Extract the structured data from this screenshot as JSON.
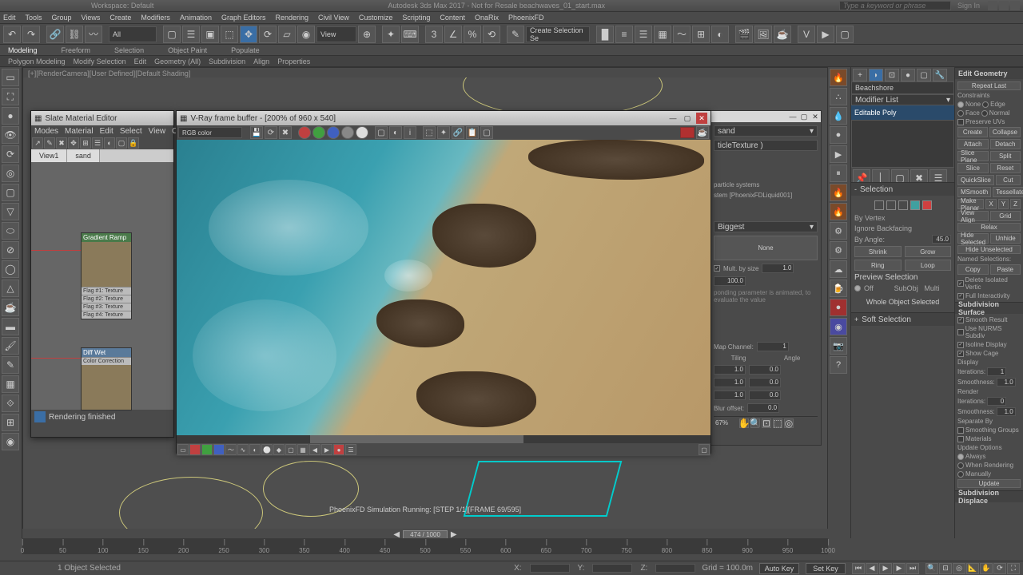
{
  "app": {
    "title": "Autodesk 3ds Max 2017 - Not for Resale   beachwaves_01_start.max",
    "workspace_label": "Workspace: Default",
    "search_placeholder": "Type a keyword or phrase",
    "signin": "Sign In"
  },
  "menu": [
    "Edit",
    "Tools",
    "Group",
    "Views",
    "Create",
    "Modifiers",
    "Animation",
    "Graph Editors",
    "Rendering",
    "Civil View",
    "Customize",
    "Scripting",
    "Content",
    "OnaRix",
    "PhoenixFD"
  ],
  "main_toolbar": {
    "dropdown_all": "All",
    "dropdown_view": "View",
    "dropdown_selset": "Create Selection Se"
  },
  "ribbon_tabs": [
    "Modeling",
    "Freeform",
    "Selection",
    "Object Paint",
    "Populate"
  ],
  "ribbon_sub": [
    "Polygon Modeling",
    "Modify Selection",
    "Edit",
    "Geometry (All)",
    "Subdivision",
    "Align",
    "Properties"
  ],
  "viewport": {
    "label": "[+][RenderCamera][User Defined][Default Shading]",
    "sim_status": "PhoenixFD Simulation Running: [STEP 1/1][FRAME 69/595]"
  },
  "slate": {
    "title": "Slate Material Editor",
    "menus": [
      "Modes",
      "Material",
      "Edit",
      "Select",
      "View",
      "Opt"
    ],
    "tabs": [
      "View1",
      "sand"
    ],
    "node1": {
      "head": "Gradient Ramp",
      "slots": [
        "Flag #1: Texture",
        "Flag #2: Texture",
        "Flag #3: Texture",
        "Flag #4: Texture"
      ]
    },
    "node2": {
      "head": "Diff Wet",
      "sub": "Color Correction"
    },
    "status": "Rendering finished"
  },
  "vfb": {
    "title": "V-Ray frame buffer - [200% of 960 x 540]",
    "channel": "RGB color"
  },
  "docked": {
    "name_field": "sand",
    "type_label": "ticleTexture )",
    "txt1": "particle systems",
    "txt2": "stem [PhoenixFDLiquid001]",
    "mode": "Biggest",
    "none": "None",
    "mult_label": "Mult. by size",
    "mult_val": "1.0",
    "val100": "100.0",
    "anim_note": "ponding parameter is animated, to evaluate the value",
    "map_channel": "Map Channel:",
    "map_channel_val": "1",
    "tiling": "Tiling",
    "angle": "Angle",
    "t1": "1.0",
    "t2": "1.0",
    "t3": "1.0",
    "a1": "0.0",
    "a2": "0.0",
    "a3": "0.0",
    "blur": "Blur offset:",
    "blur_val": "0.0",
    "zoom": "67%"
  },
  "command_panel": {
    "name": "Beachshore",
    "modifier_list": "Modifier List",
    "stack_item": "Editable Poly",
    "selection_head": "Selection",
    "by_vertex": "By Vertex",
    "ignore_backfacing": "Ignore Backfacing",
    "by_angle": "By Angle:",
    "by_angle_val": "45.0",
    "shrink": "Shrink",
    "grow": "Grow",
    "ring": "Ring",
    "loop": "Loop",
    "preview_sel": "Preview Selection",
    "off": "Off",
    "subobj": "SubObj",
    "multi": "Multi",
    "whole": "Whole Object Selected",
    "softsel_head": "Soft Selection"
  },
  "edit_geom": {
    "head": "Edit Geometry",
    "repeat": "Repeat Last",
    "constraints": "Constraints",
    "none": "None",
    "edge": "Edge",
    "face": "Face",
    "normal": "Normal",
    "preserve_uvs": "Preserve UVs",
    "create": "Create",
    "collapse": "Collapse",
    "attach": "Attach",
    "detach": "Detach",
    "slice_plane": "Slice Plane",
    "split": "Split",
    "slice": "Slice",
    "reset": "Reset",
    "quickslice": "QuickSlice",
    "cut": "Cut",
    "msmooth": "MSmooth",
    "tessellate": "Tessellate",
    "make_planar": "Make Planar",
    "x": "X",
    "y": "Y",
    "z": "Z",
    "view_align": "View Align",
    "grid_align": "Grid",
    "relax": "Relax",
    "hide_sel": "Hide Selected",
    "unhide": "Unhide",
    "hide_unsel": "Hide Unselected",
    "named_sel": "Named Selections:",
    "copy": "Copy",
    "paste": "Paste",
    "del_iso": "Delete Isolated Vertic",
    "full_int": "Full Interactivity",
    "subdiv_head": "Subdivision Surface",
    "smooth_result": "Smooth Result",
    "use_nurms": "Use NURMS Subdiv",
    "isoline": "Isoline Display",
    "show_cage": "Show Cage",
    "display": "Display",
    "iterations": "Iterations:",
    "iter_val": "1",
    "smoothness": "Smoothness:",
    "smooth_val": "1.0",
    "render": "Render",
    "r_iter_val": "0",
    "r_smooth_val": "1.0",
    "sep_by": "Separate By",
    "sm_groups": "Smoothing Groups",
    "materials": "Materials",
    "update_opts": "Update Options",
    "always": "Always",
    "when_render": "When Rendering",
    "manually": "Manually",
    "update": "Update",
    "subdiv_disp": "Subdivision Displace"
  },
  "timeline": {
    "thumb": "474 / 1000",
    "ticks": [
      "0",
      "50",
      "100",
      "150",
      "200",
      "250",
      "300",
      "350",
      "400",
      "450",
      "500",
      "550",
      "600",
      "650",
      "700",
      "750",
      "800",
      "850",
      "900",
      "950",
      "1000"
    ]
  },
  "status": {
    "selected": "1 Object Selected",
    "x": "X:",
    "y": "Y:",
    "z": "Z:",
    "grid": "Grid = 100.0m",
    "autokey": "Auto Key",
    "setkey": "Set Key"
  }
}
